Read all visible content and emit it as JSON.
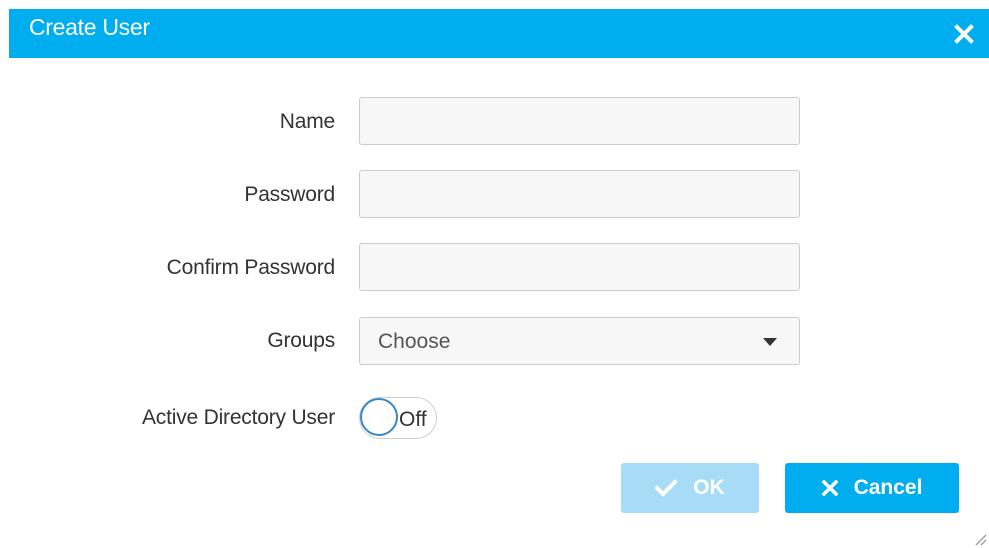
{
  "dialog": {
    "title": "Create User",
    "close_icon": "close-icon"
  },
  "form": {
    "name": {
      "label": "Name",
      "value": "",
      "placeholder": ""
    },
    "password": {
      "label": "Password",
      "value": "",
      "placeholder": ""
    },
    "confirm_password": {
      "label": "Confirm Password",
      "value": "",
      "placeholder": ""
    },
    "groups": {
      "label": "Groups",
      "selected": "Choose",
      "caret_icon": "caret-down-icon"
    },
    "active_directory": {
      "label": "Active Directory User",
      "state": "Off"
    }
  },
  "buttons": {
    "ok": {
      "label": "OK",
      "icon": "check-icon",
      "enabled": false
    },
    "cancel": {
      "label": "Cancel",
      "icon": "close-icon",
      "enabled": true
    }
  },
  "colors": {
    "header": "#00aeef",
    "primary_button": "#00aeef",
    "disabled_button": "#a8dcf6",
    "toggle_border": "#3a87c8"
  }
}
